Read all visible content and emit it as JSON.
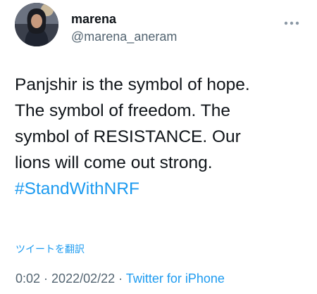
{
  "tweet": {
    "author": {
      "display_name": "marena",
      "handle": "@marena_aneram"
    },
    "text_lines": [
      "Panjshir is the symbol of hope.",
      "The symbol of freedom. The",
      "symbol of RESISTANCE. Our",
      "lions will come out strong."
    ],
    "hashtag": "#StandWithNRF",
    "translate_label": "ツイートを翻訳",
    "meta": {
      "time": "0:02",
      "separator": " · ",
      "date": "2022/02/22",
      "separator2": " · ",
      "source": "Twitter for iPhone"
    }
  },
  "icons": {
    "more": "more-horizontal-icon"
  },
  "colors": {
    "text": "#0f1419",
    "secondary": "#536471",
    "accent": "#1d9bf0"
  }
}
